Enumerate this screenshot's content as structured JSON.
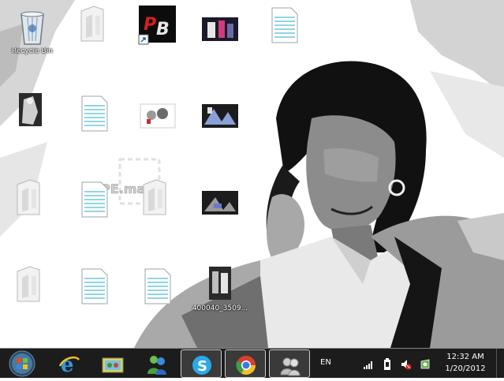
{
  "desktop": {
    "icons": [
      {
        "label": "Recycle Bin"
      },
      {
        "label": ""
      },
      {
        "label": ""
      },
      {
        "label": ""
      },
      {
        "label": ""
      },
      {
        "label": ""
      },
      {
        "label": ""
      },
      {
        "label": ""
      },
      {
        "label": ""
      },
      {
        "label": ""
      },
      {
        "label": ""
      },
      {
        "label": ""
      },
      {
        "label": ""
      },
      {
        "label": ""
      },
      {
        "label": ""
      },
      {
        "label": ""
      },
      {
        "label": ""
      },
      {
        "label": "400040_3509..."
      }
    ],
    "watermark_text": "PE.ma"
  },
  "taskbar": {
    "apps": [
      {
        "icon": "internet-explorer-icon"
      },
      {
        "icon": "games-folder-icon"
      },
      {
        "icon": "windows-live-messenger-icon"
      },
      {
        "icon": "skype-icon"
      },
      {
        "icon": "chrome-icon"
      },
      {
        "icon": "users-icon"
      }
    ],
    "language": "EN",
    "clock": {
      "time": "12:32 AM",
      "date": "1/20/2012"
    }
  }
}
